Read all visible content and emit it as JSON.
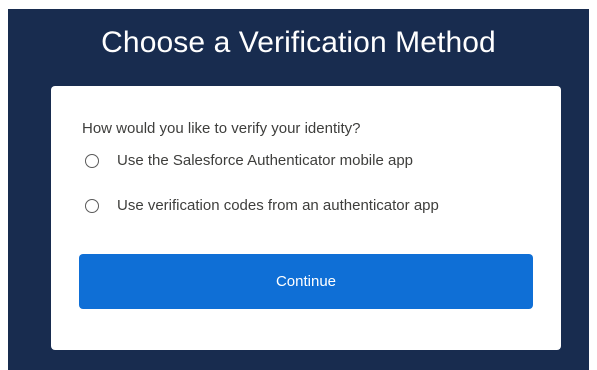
{
  "page": {
    "title": "Choose a Verification Method"
  },
  "form": {
    "question": "How would you like to verify your identity?",
    "options": [
      {
        "label": "Use the Salesforce Authenticator mobile app",
        "selected": false
      },
      {
        "label": "Use verification codes from an authenticator app",
        "selected": false
      }
    ],
    "continue_label": "Continue"
  },
  "colors": {
    "background": "#182c4f",
    "card": "#ffffff",
    "primary_button": "#0f6fd6",
    "text": "#3e3e3c"
  }
}
